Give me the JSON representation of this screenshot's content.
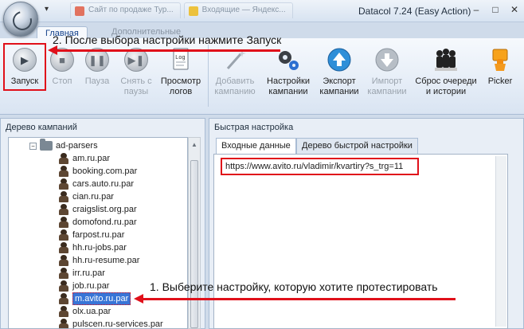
{
  "window": {
    "title": "Datacol 7.24 (Easy Action)",
    "browser_tabs": [
      "Сайт по продаже Тур...",
      "Входящие — Яндекс..."
    ]
  },
  "ribbon": {
    "tabs": [
      "Главная",
      "Дополнительные"
    ],
    "buttons": [
      {
        "label": "Запуск",
        "icon": "play-icon",
        "enabled": true
      },
      {
        "label": "Стоп",
        "icon": "stop-icon",
        "enabled": false
      },
      {
        "label": "Пауза",
        "icon": "pause-icon",
        "enabled": false
      },
      {
        "label": "Снять с паузы",
        "icon": "resume-icon",
        "enabled": false
      },
      {
        "label": "Просмотр логов",
        "icon": "log-icon",
        "enabled": true
      },
      {
        "label": "Добавить кампанию",
        "icon": "magic-wand-icon",
        "enabled": false
      },
      {
        "label": "Настройки кампании",
        "icon": "gears-icon",
        "enabled": true
      },
      {
        "label": "Экспорт кампании",
        "icon": "export-icon",
        "enabled": true
      },
      {
        "label": "Импорт кампании",
        "icon": "import-icon",
        "enabled": false
      },
      {
        "label": "Сброс очереди и истории",
        "icon": "reset-queue-icon",
        "enabled": true
      },
      {
        "label": "Picker",
        "icon": "picker-icon",
        "enabled": true
      }
    ]
  },
  "annotations": {
    "step1": "1. Выберите настройку, которую хотите протестировать",
    "step2": "2. После выбора настройки нажмите Запуск"
  },
  "left_panel": {
    "title": "Дерево кампаний",
    "folder": "ad-parsers",
    "items": [
      "am.ru.par",
      "booking.com.par",
      "cars.auto.ru.par",
      "cian.ru.par",
      "craigslist.org.par",
      "domofond.ru.par",
      "farpost.ru.par",
      "hh.ru-jobs.par",
      "hh.ru-resume.par",
      "irr.ru.par",
      "job.ru.par",
      "m.avito.ru.par",
      "olx.ua.par",
      "pulscen.ru-services.par"
    ],
    "selected_index": 11
  },
  "right_panel": {
    "title": "Быстрая настройка",
    "tabs": [
      "Входные данные",
      "Дерево быстрой настройки"
    ],
    "url": "https://www.avito.ru/vladimir/kvartiry?s_trg=11"
  },
  "colors": {
    "annotation_red": "#e0101a",
    "selection_blue": "#3875d7",
    "ribbon_border": "#a9bcd4"
  }
}
